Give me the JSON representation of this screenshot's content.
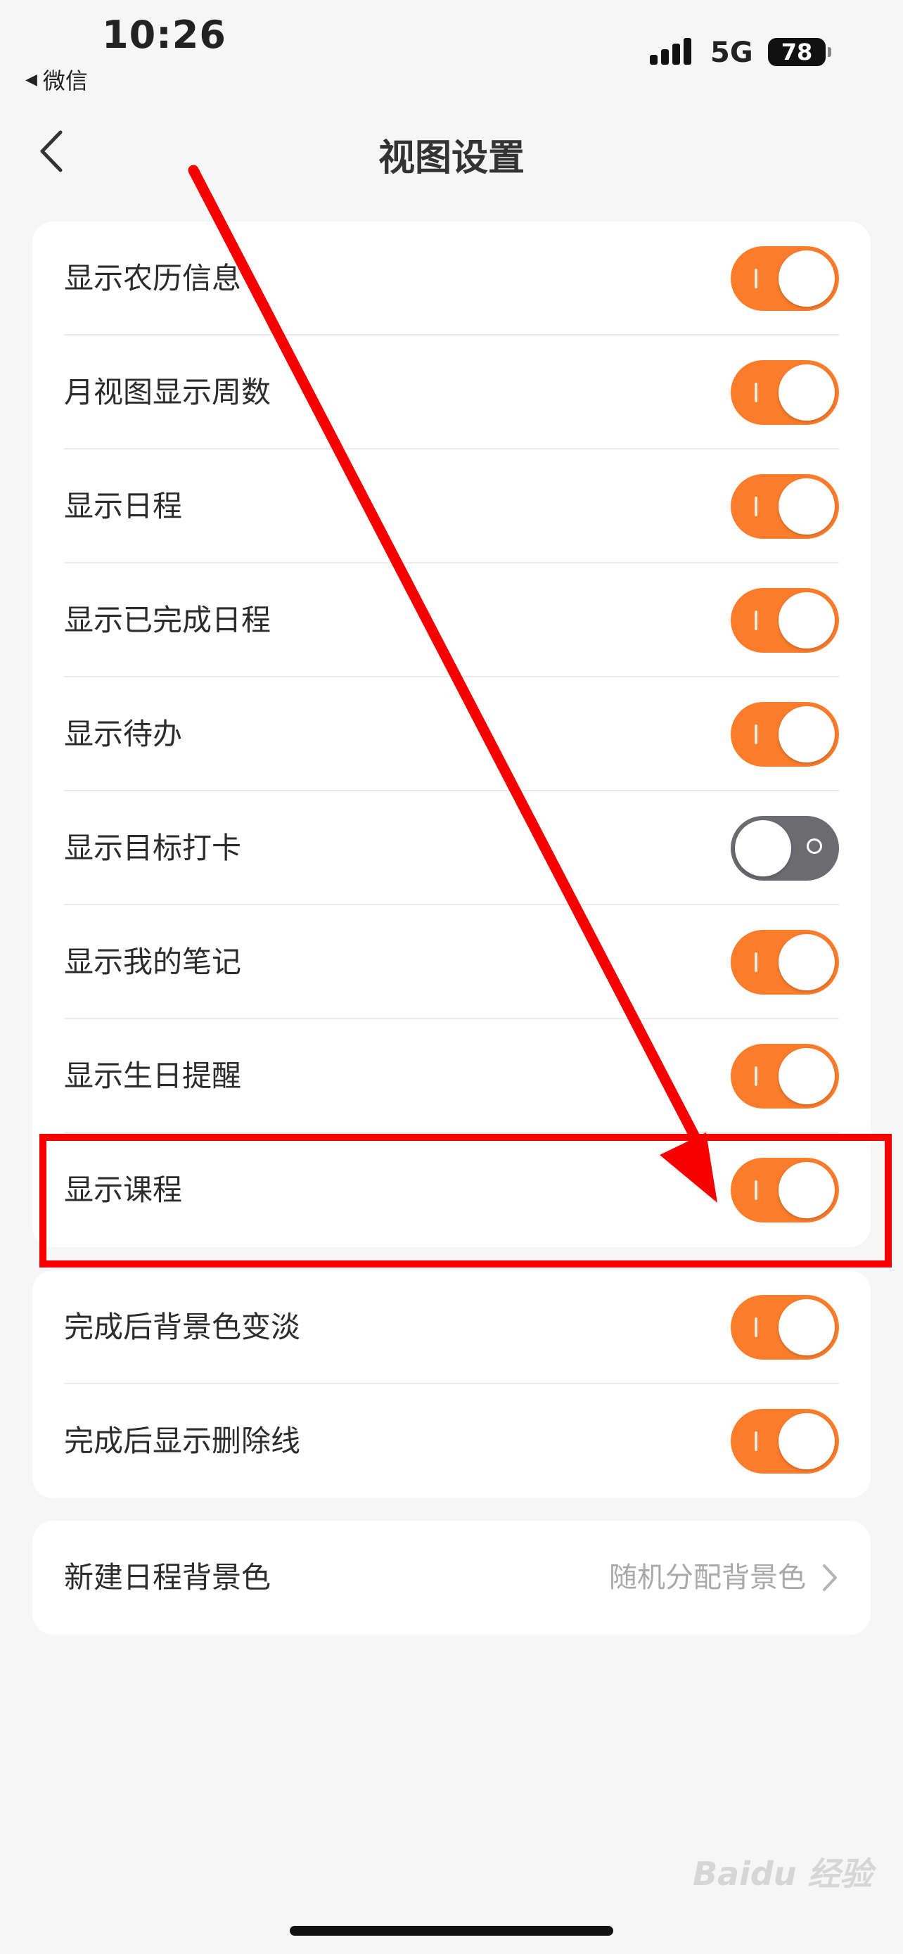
{
  "status_bar": {
    "time": "10:26",
    "back_app_label": "微信",
    "network": "5G",
    "battery": "78"
  },
  "nav": {
    "title": "视图设置"
  },
  "toggles": [
    {
      "label": "显示农历信息",
      "on": true
    },
    {
      "label": "月视图显示周数",
      "on": true
    },
    {
      "label": "显示日程",
      "on": true
    },
    {
      "label": "显示已完成日程",
      "on": true
    },
    {
      "label": "显示待办",
      "on": true
    },
    {
      "label": "显示目标打卡",
      "on": false
    },
    {
      "label": "显示我的笔记",
      "on": true
    },
    {
      "label": "显示生日提醒",
      "on": true
    },
    {
      "label": "显示课程",
      "on": true
    }
  ],
  "toggles_group2": [
    {
      "label": "完成后背景色变淡",
      "on": true
    },
    {
      "label": "完成后显示删除线",
      "on": true
    }
  ],
  "background_setting": {
    "label": "新建日程背景色",
    "value": "随机分配背景色"
  },
  "watermark": "Baidu 经验",
  "colors": {
    "accent": "#fb7d2c",
    "switch_off": "#6b6b70",
    "annotation_red": "#f60000"
  }
}
